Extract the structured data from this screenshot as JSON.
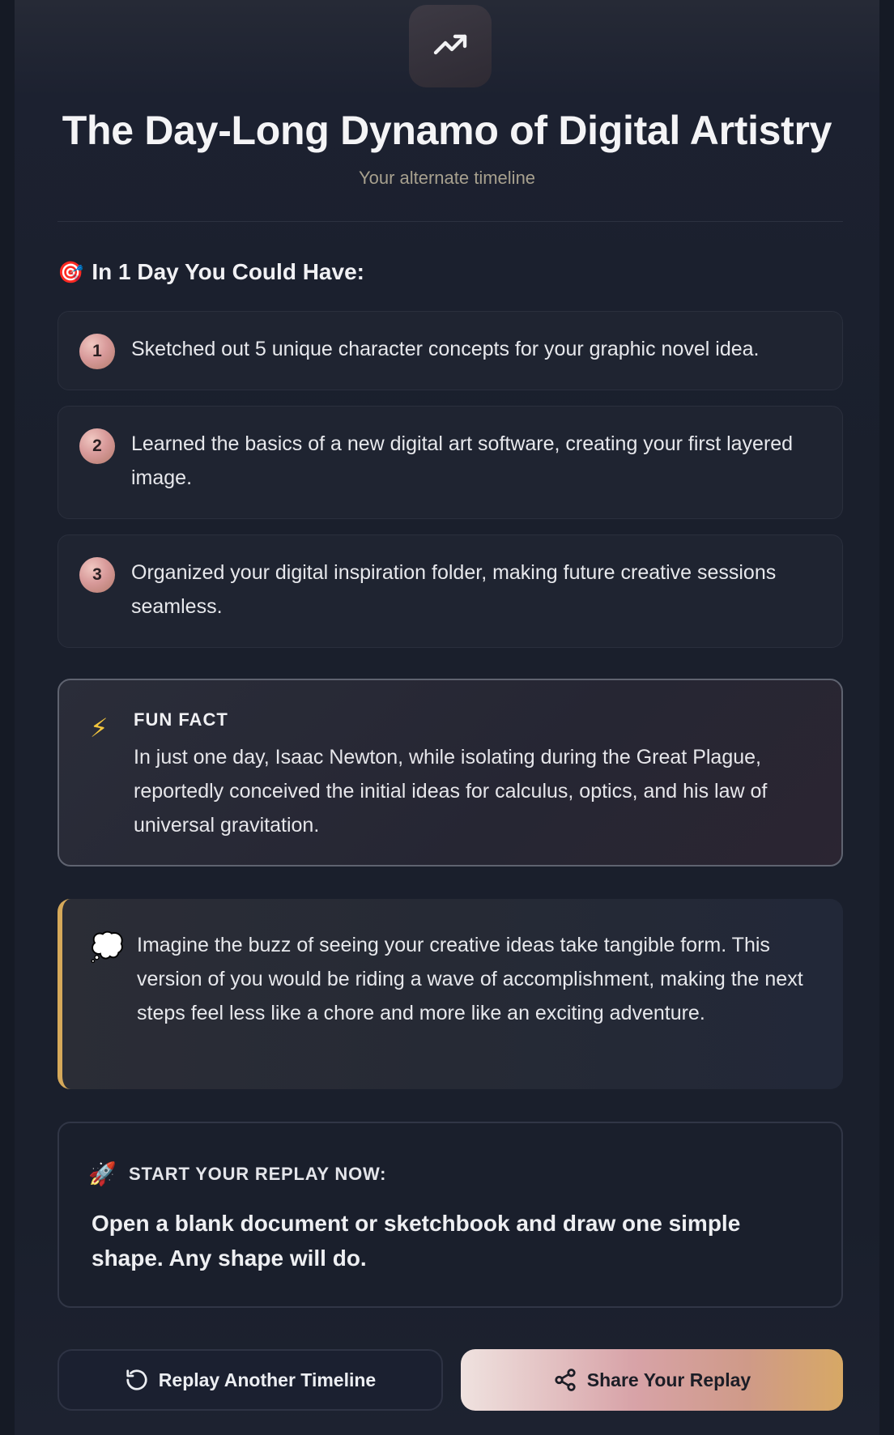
{
  "header": {
    "icon": "trending-up-icon",
    "title": "The Day-Long Dynamo of Digital Artistry",
    "subtitle": "Your alternate timeline"
  },
  "achievements": {
    "heading_emoji": "🎯",
    "heading": "In 1 Day You Could Have:",
    "items": [
      {
        "number": "1",
        "text": "Sketched out 5 unique character concepts for your graphic novel idea."
      },
      {
        "number": "2",
        "text": "Learned the basics of a new digital art software, creating your first layered image."
      },
      {
        "number": "3",
        "text": "Organized your digital inspiration folder, making future creative sessions seamless."
      }
    ]
  },
  "fun_fact": {
    "icon": "⚡",
    "label": "FUN FACT",
    "text": "In just one day, Isaac Newton, while isolating during the Great Plague, reportedly conceived the initial ideas for calculus, optics, and his law of universal gravitation."
  },
  "reflection": {
    "icon": "💭",
    "text": "Imagine the buzz of seeing your creative ideas take tangible form. This version of you would be riding a wave of accomplishment, making the next steps feel less like a chore and more like an exciting adventure.",
    "accent_color": "#d6a95a"
  },
  "call_to_action": {
    "icon": "🚀",
    "label": "START YOUR REPLAY NOW:",
    "text": "Open a blank document or sketchbook and draw one simple shape. Any shape will do."
  },
  "actions": {
    "replay_label": "Replay Another Timeline",
    "replay_icon": "refresh-icon",
    "share_label": "Share Your Replay",
    "share_icon": "share-icon"
  }
}
